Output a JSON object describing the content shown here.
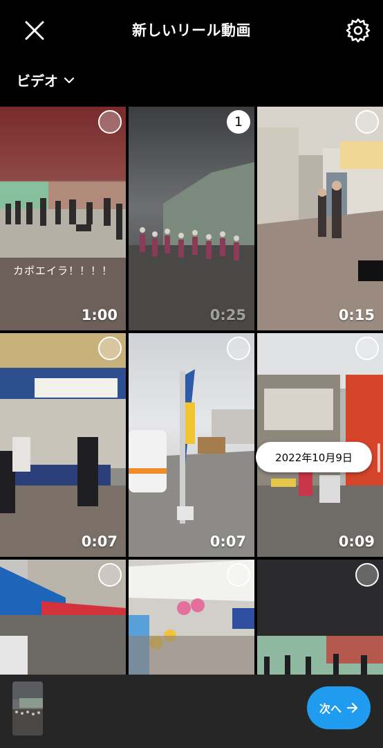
{
  "header": {
    "title": "新しいリール動画",
    "close_icon": "close-icon",
    "settings_icon": "gear-icon"
  },
  "source_selector": {
    "label": "ビデオ",
    "icon": "chevron-down-icon"
  },
  "grid": {
    "tiles": [
      {
        "duration": "1:00",
        "caption": "カポエイラ！！！！",
        "selection": ""
      },
      {
        "duration": "0:25",
        "selection": "1"
      },
      {
        "duration": "0:15",
        "selection": ""
      },
      {
        "duration": "0:07",
        "selection": ""
      },
      {
        "duration": "0:07",
        "selection": ""
      },
      {
        "duration": "0:09",
        "selection": ""
      },
      {
        "duration": "",
        "selection": ""
      },
      {
        "duration": "",
        "selection": ""
      },
      {
        "duration": "",
        "selection": ""
      }
    ],
    "date_indicator": "2022年10月9日"
  },
  "footer": {
    "next_label": "次へ",
    "next_icon": "arrow-right-icon"
  },
  "colors": {
    "background": "#000000",
    "accent": "#1f9bf0",
    "bottom_bar": "#262626"
  }
}
